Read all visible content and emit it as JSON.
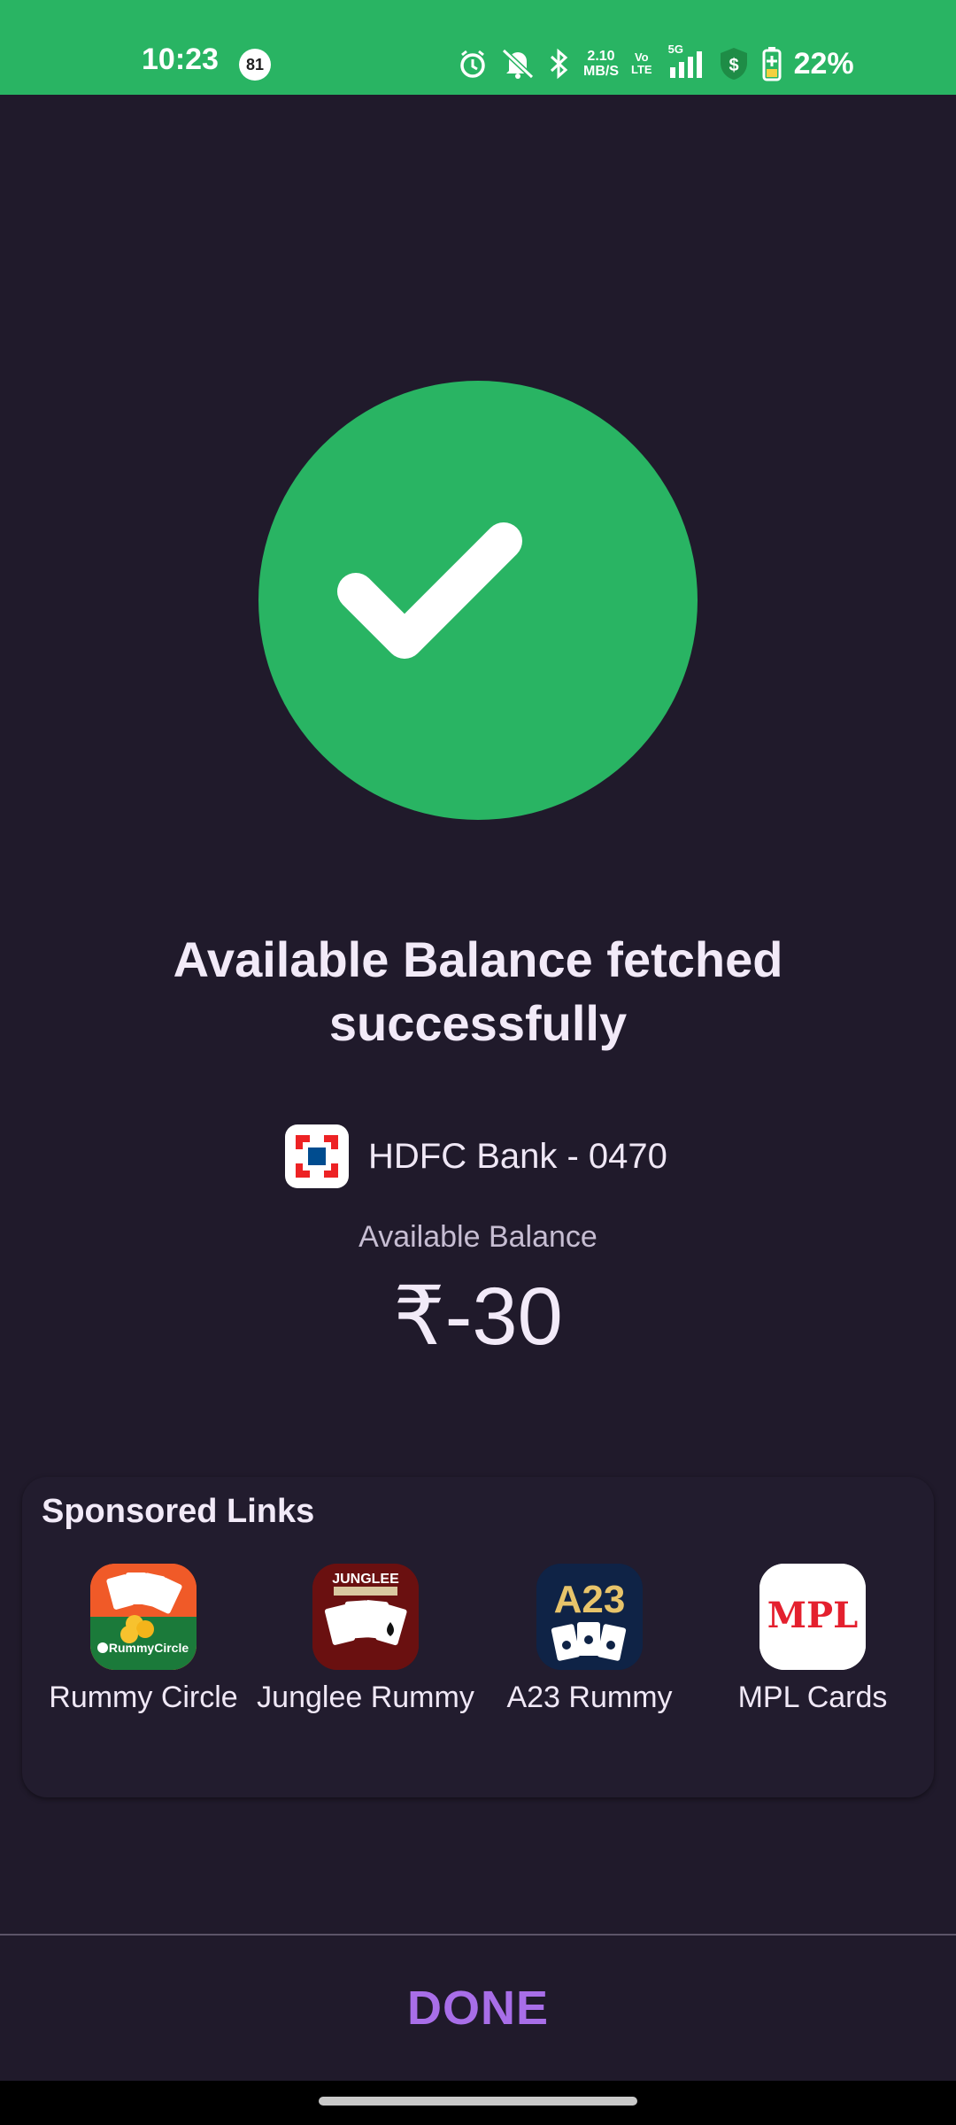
{
  "status_bar": {
    "time": "10:23",
    "notification_count": "81",
    "network_speed_value": "2.10",
    "network_speed_unit": "MB/S",
    "volte_top": "Vo",
    "volte_bottom": "LTE",
    "network_type": "5G",
    "battery_percent": "22%",
    "icons": [
      "alarm-icon",
      "mute-icon",
      "bluetooth-icon",
      "signal-icon",
      "shield-dollar-icon",
      "battery-charging-icon"
    ]
  },
  "result": {
    "title": "Available Balance fetched successfully",
    "bank_name": "HDFC Bank - 0470",
    "balance_label": "Available Balance",
    "balance_value": "₹-30"
  },
  "sponsored": {
    "title": "Sponsored Links",
    "apps": [
      {
        "name": "Rummy Circle",
        "icon": "rummy-circle-app-icon"
      },
      {
        "name": "Junglee Rummy",
        "icon": "junglee-rummy-app-icon"
      },
      {
        "name": "A23 Rummy",
        "icon": "a23-rummy-app-icon"
      },
      {
        "name": "MPL Cards",
        "icon": "mpl-cards-app-icon"
      }
    ],
    "icon_text": {
      "rummy_circle": "RummyCircle",
      "junglee": "JUNGLEE",
      "a23": "A23",
      "mpl": "MPL"
    }
  },
  "footer": {
    "done_label": "DONE"
  },
  "colors": {
    "background": "#201a2b",
    "accent_green": "#29b463",
    "done_purple": "#a86ee8"
  }
}
